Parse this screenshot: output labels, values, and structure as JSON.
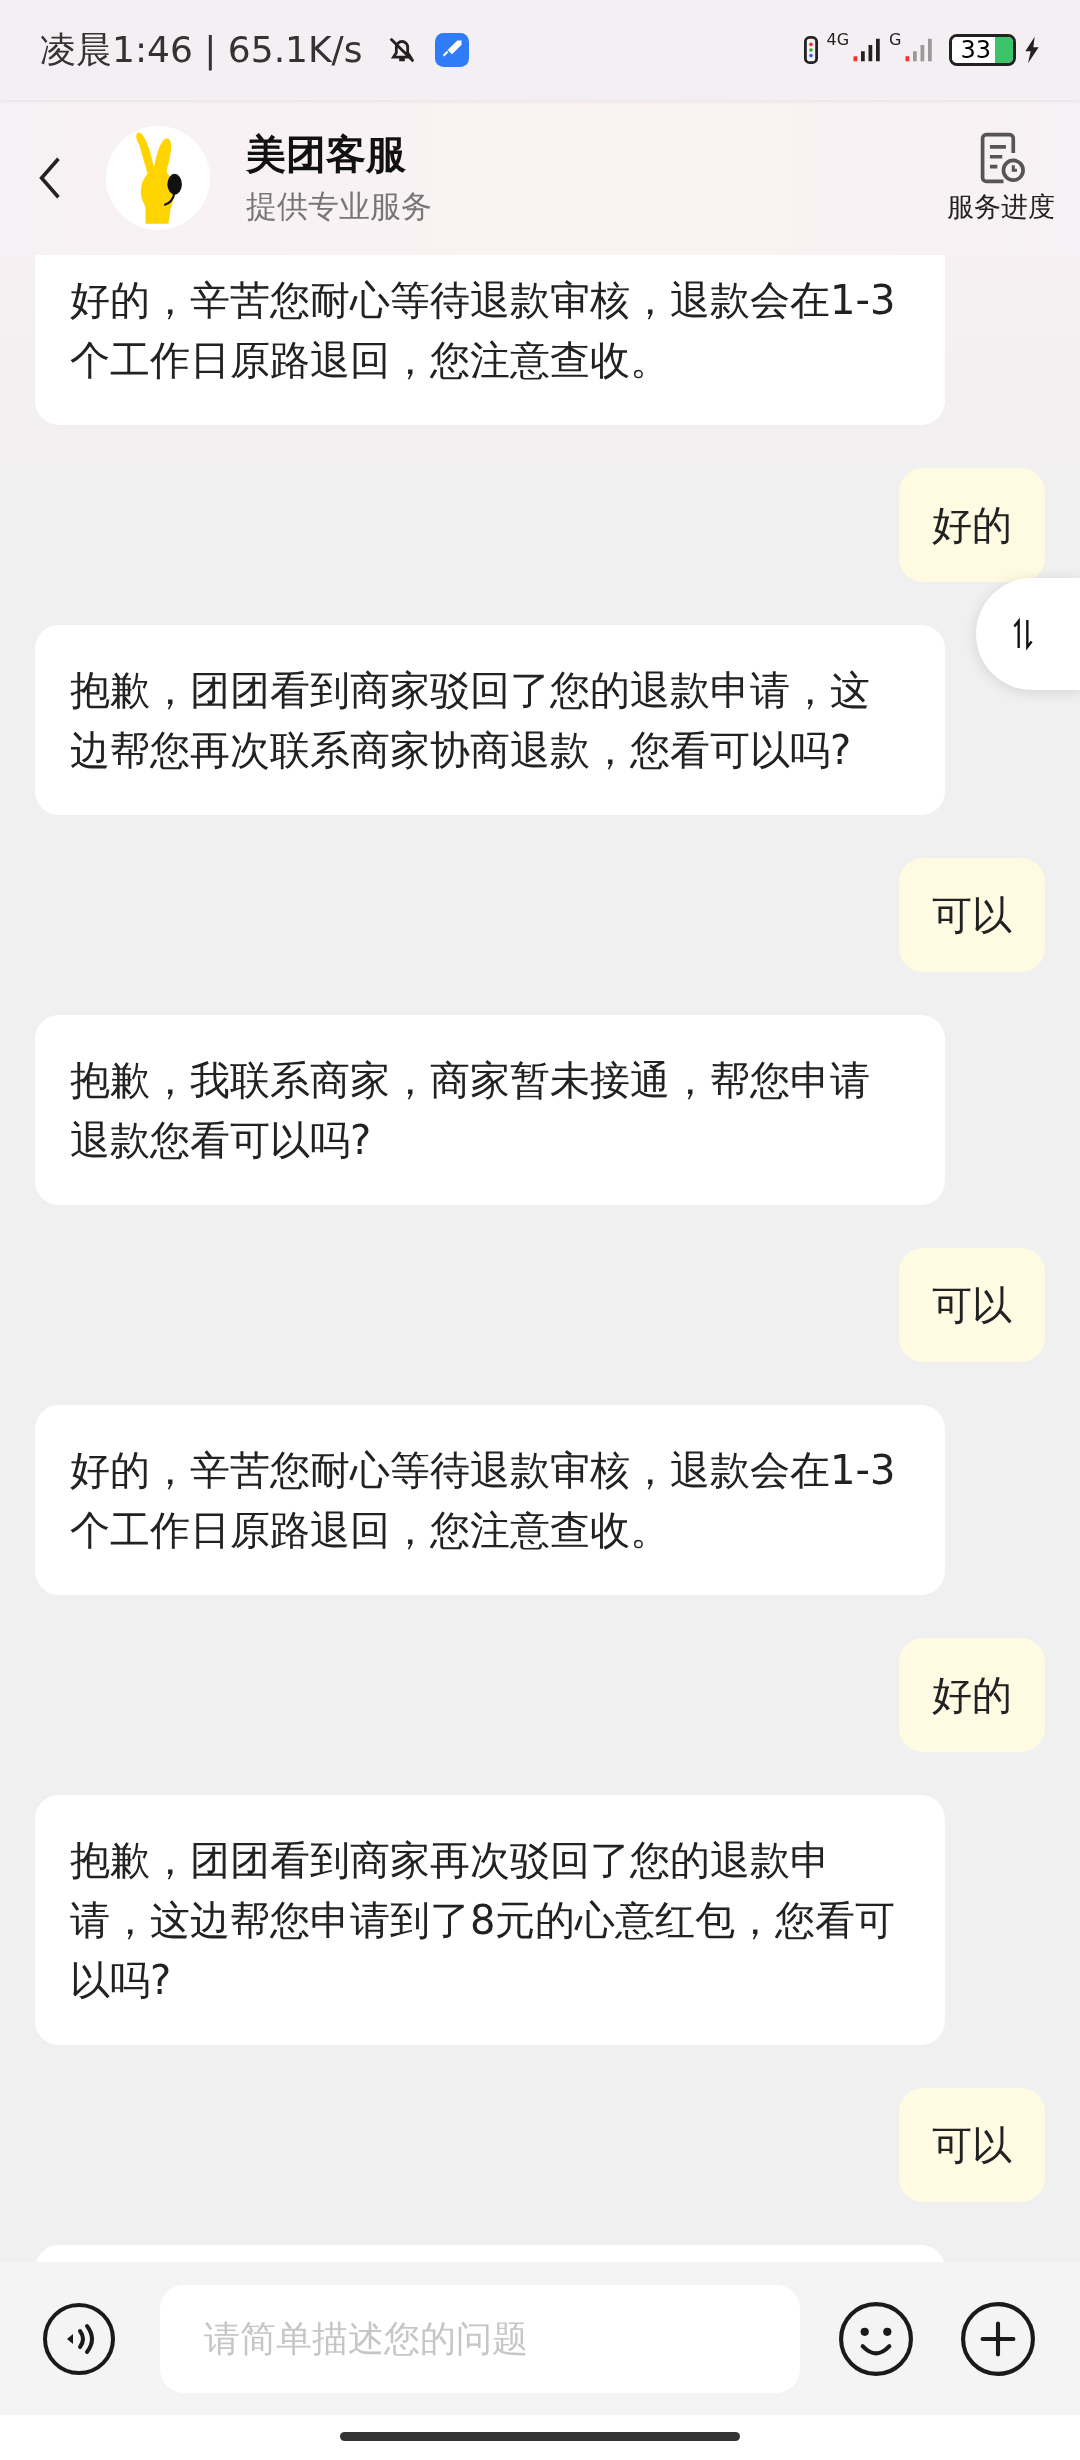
{
  "status_bar": {
    "time_speed": "凌晨1:46 | 65.1K/s",
    "network_1": "4G",
    "network_2": "G",
    "battery": "33"
  },
  "header": {
    "title": "美团客服",
    "subtitle": "提供专业服务",
    "action": "服务进度"
  },
  "messages": [
    {
      "kind": "agent",
      "lines": [
        "好的，辛苦您耐心等待退款审核，退款会在1-3",
        "个工作日原路退回，您注意查收。"
      ]
    },
    {
      "kind": "user",
      "lines": [
        "好的"
      ]
    },
    {
      "kind": "agent",
      "lines": [
        "抱歉，团团看到商家驳回了您的退款申请，这",
        "边帮您再次联系商家协商退款，您看可以吗?"
      ]
    },
    {
      "kind": "user",
      "lines": [
        "可以"
      ]
    },
    {
      "kind": "agent",
      "lines": [
        "抱歉，我联系商家，商家暂未接通，帮您申请",
        "退款您看可以吗?"
      ]
    },
    {
      "kind": "user",
      "lines": [
        "可以"
      ]
    },
    {
      "kind": "agent",
      "lines": [
        "好的，辛苦您耐心等待退款审核，退款会在1-3",
        "个工作日原路退回，您注意查收。"
      ]
    },
    {
      "kind": "user",
      "lines": [
        "好的"
      ]
    },
    {
      "kind": "agent",
      "lines": [
        "抱歉，团团看到商家再次驳回了您的退款申",
        "请，这边帮您申请到了8元的心意红包，您看可",
        "以吗?"
      ]
    },
    {
      "kind": "user",
      "lines": [
        "可以"
      ]
    },
    {
      "kind": "agent"
    }
  ],
  "input": {
    "placeholder": "请简单描述您的问题"
  }
}
